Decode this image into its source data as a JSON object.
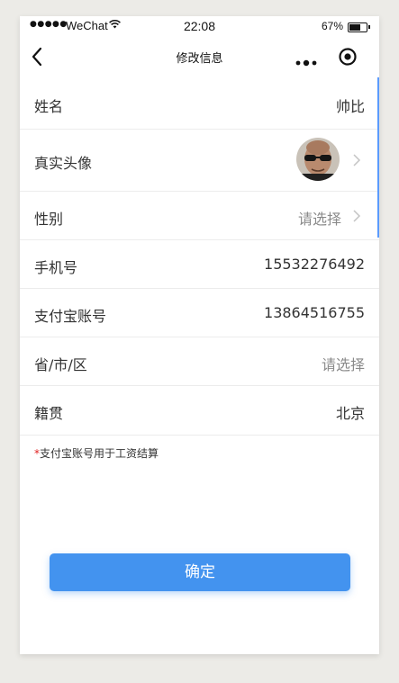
{
  "status_bar": {
    "signal": "●●●●●",
    "carrier": "WeChat",
    "time": "22:08",
    "battery_percent_text": "67%",
    "battery_level": 0.67
  },
  "nav": {
    "title": "修改信息",
    "back_icon": "chevron-left-icon",
    "more_icon": "more-dots-icon",
    "record_icon": "record-circle-icon"
  },
  "form": {
    "name": {
      "label": "姓名",
      "value": "帅比"
    },
    "avatar": {
      "label": "真实头像"
    },
    "gender": {
      "label": "性别",
      "value": "请选择"
    },
    "phone": {
      "label": "手机号",
      "value": "15532276492"
    },
    "alipay": {
      "label": "支付宝账号",
      "value": "13864516755"
    },
    "region": {
      "label": "省/市/区",
      "value": "请选择"
    },
    "hometown": {
      "label": "籍贯",
      "value": "北京"
    }
  },
  "note": {
    "star": "*",
    "text": "支付宝账号用于工资结算"
  },
  "confirm_label": "确定",
  "colors": {
    "accent": "#4393ef",
    "required_star": "#e02020",
    "placeholder": "#8a8a8a"
  }
}
